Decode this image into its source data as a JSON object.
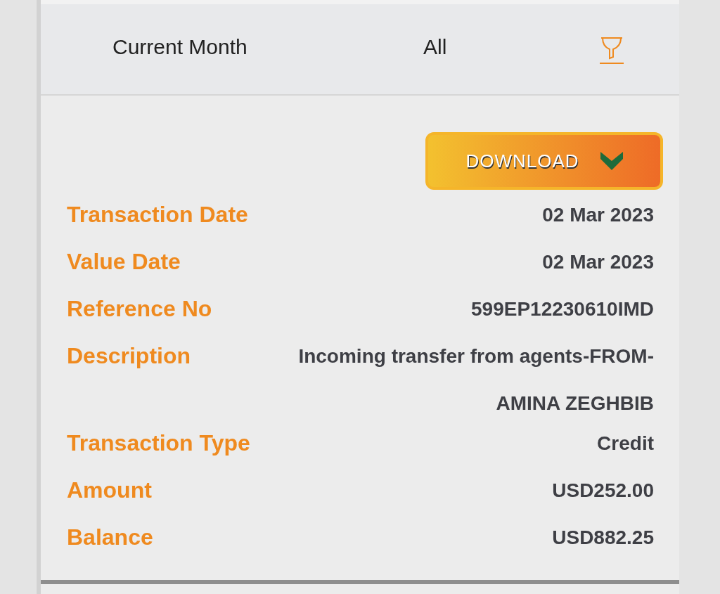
{
  "filter_bar": {
    "period": "Current Month",
    "type": "All"
  },
  "download_button": {
    "label": "DOWNLOAD"
  },
  "details": [
    {
      "label": "Transaction Date",
      "value": "02 Mar 2023"
    },
    {
      "label": "Value Date",
      "value": "02 Mar 2023"
    },
    {
      "label": "Reference No",
      "value": "599EP12230610IMD"
    },
    {
      "label": "Description",
      "value": "Incoming transfer from agents-FROM- AMINA ZEGHBIB"
    },
    {
      "label": "Transaction Type",
      "value": "Credit"
    },
    {
      "label": "Amount",
      "value": "USD252.00"
    },
    {
      "label": "Balance",
      "value": "USD882.25"
    }
  ]
}
